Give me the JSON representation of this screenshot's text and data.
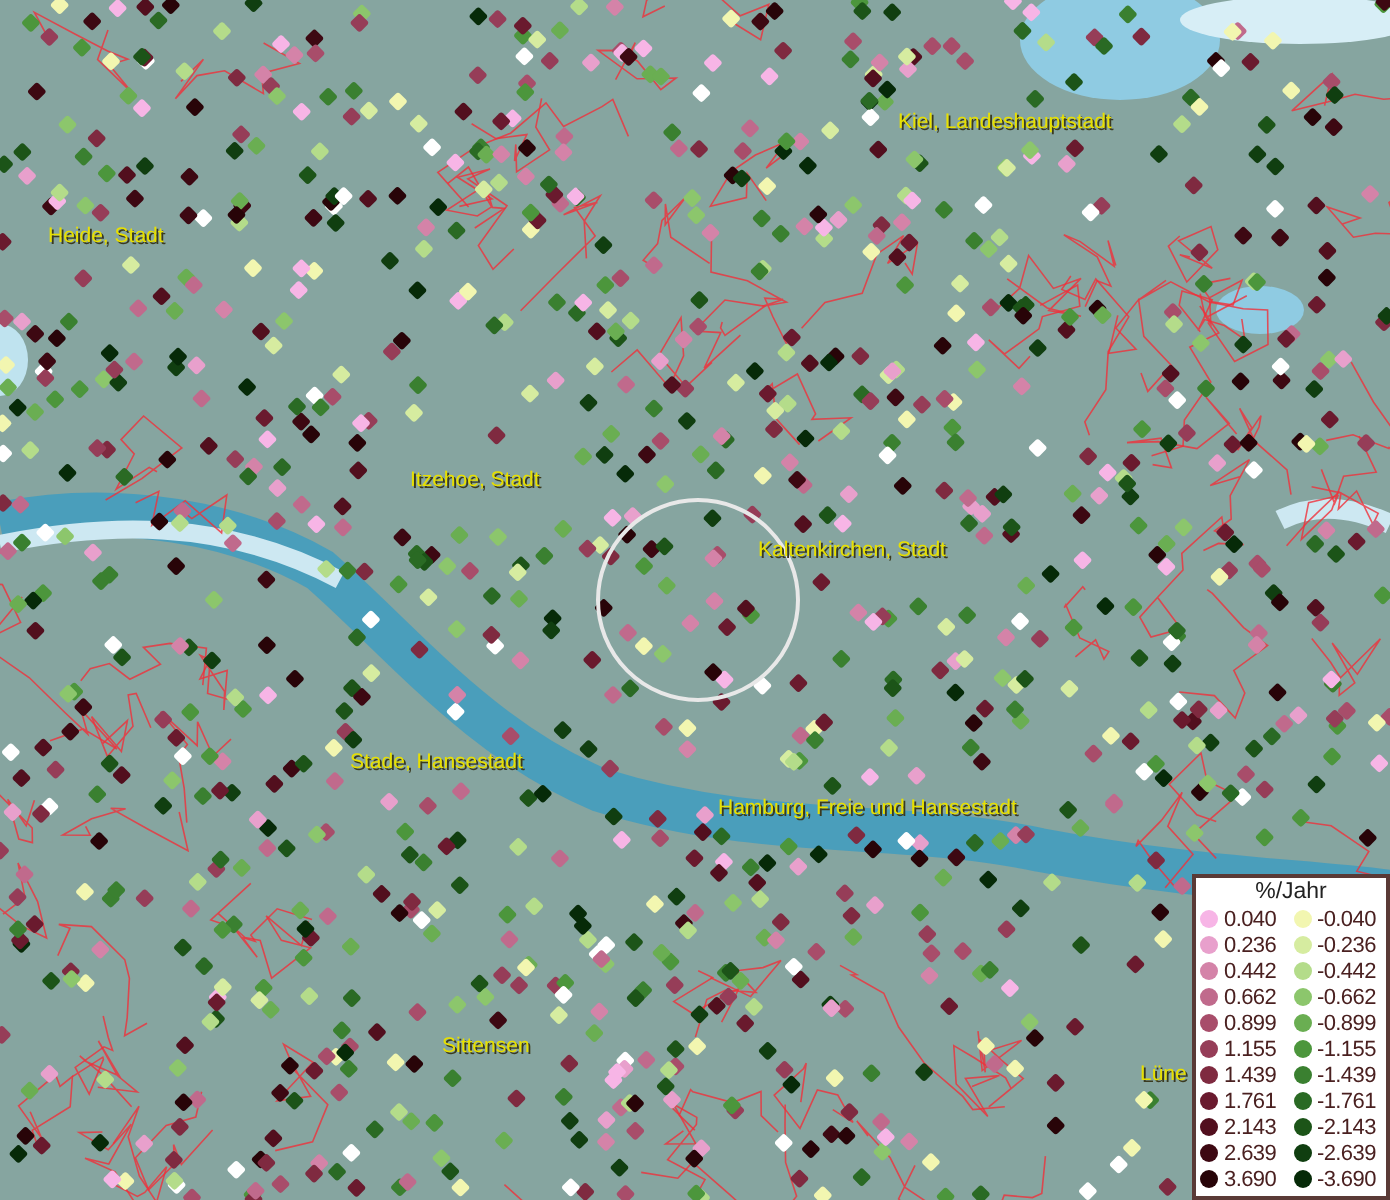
{
  "map": {
    "place_labels": [
      {
        "text": "Kiel, Landeshauptstadt"
      },
      {
        "text": "Heide, Stadt"
      },
      {
        "text": "Itzehoe, Stadt"
      },
      {
        "text": "Kaltenkirchen, Stadt"
      },
      {
        "text": "Stade, Hansestadt"
      },
      {
        "text": "Hamburg, Freie und Hansestadt"
      },
      {
        "text": "Sittensen"
      },
      {
        "text": "Lüne"
      }
    ]
  },
  "legend": {
    "title": "%/Jahr",
    "positive": [
      {
        "label": "0.040",
        "color": "#f7b5e6"
      },
      {
        "label": "0.236",
        "color": "#e8a0cc"
      },
      {
        "label": "0.442",
        "color": "#d483a8"
      },
      {
        "label": "0.662",
        "color": "#c06a8c"
      },
      {
        "label": "0.899",
        "color": "#a84d6a"
      },
      {
        "label": "1.155",
        "color": "#963d58"
      },
      {
        "label": "1.439",
        "color": "#7f2a40"
      },
      {
        "label": "1.761",
        "color": "#6a1a2e"
      },
      {
        "label": "2.143",
        "color": "#520f1e"
      },
      {
        "label": "2.639",
        "color": "#3d0812"
      },
      {
        "label": "3.690",
        "color": "#280408"
      }
    ],
    "negative": [
      {
        "label": "-0.040",
        "color": "#f2f6b0"
      },
      {
        "label": "-0.236",
        "color": "#d6eca0"
      },
      {
        "label": "-0.442",
        "color": "#b4dc8a"
      },
      {
        "label": "-0.662",
        "color": "#8cc66c"
      },
      {
        "label": "-0.899",
        "color": "#6aae52"
      },
      {
        "label": "-1.155",
        "color": "#4c963c"
      },
      {
        "label": "-1.439",
        "color": "#3a8030"
      },
      {
        "label": "-1.761",
        "color": "#2a6a24"
      },
      {
        "label": "-2.143",
        "color": "#1c5418"
      },
      {
        "label": "-2.639",
        "color": "#103e10"
      },
      {
        "label": "-3.690",
        "color": "#062a08"
      }
    ]
  }
}
